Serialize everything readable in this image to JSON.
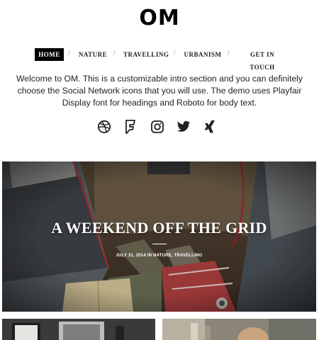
{
  "site": {
    "logo": "OM"
  },
  "nav": {
    "items": [
      {
        "label": "HOME",
        "active": true
      },
      {
        "label": "NATURE",
        "active": false
      },
      {
        "label": "TRAVELLING",
        "active": false
      },
      {
        "label": "URBANISM",
        "active": false
      },
      {
        "label": "GET IN TOUCH",
        "active": false
      }
    ],
    "separator": "/"
  },
  "intro": {
    "text": "Welcome to OM. This is a customizable intro section and you can definitely choose the Social Network icons that you will use. The demo uses Playfair Display font for headings and Roboto for body text."
  },
  "social": {
    "icons": [
      "dribbble-icon",
      "foursquare-icon",
      "instagram-icon",
      "twitter-icon",
      "xing-icon"
    ],
    "color": "#222222"
  },
  "featured": {
    "title": "A WEEKEND OFF THE GRID",
    "date": "JULY 31, 2014",
    "in_label": "IN",
    "categories": "NATURE, TRAVELLING"
  },
  "colors": {
    "accent": "#000000",
    "text": "#222222",
    "background": "#ffffff"
  }
}
